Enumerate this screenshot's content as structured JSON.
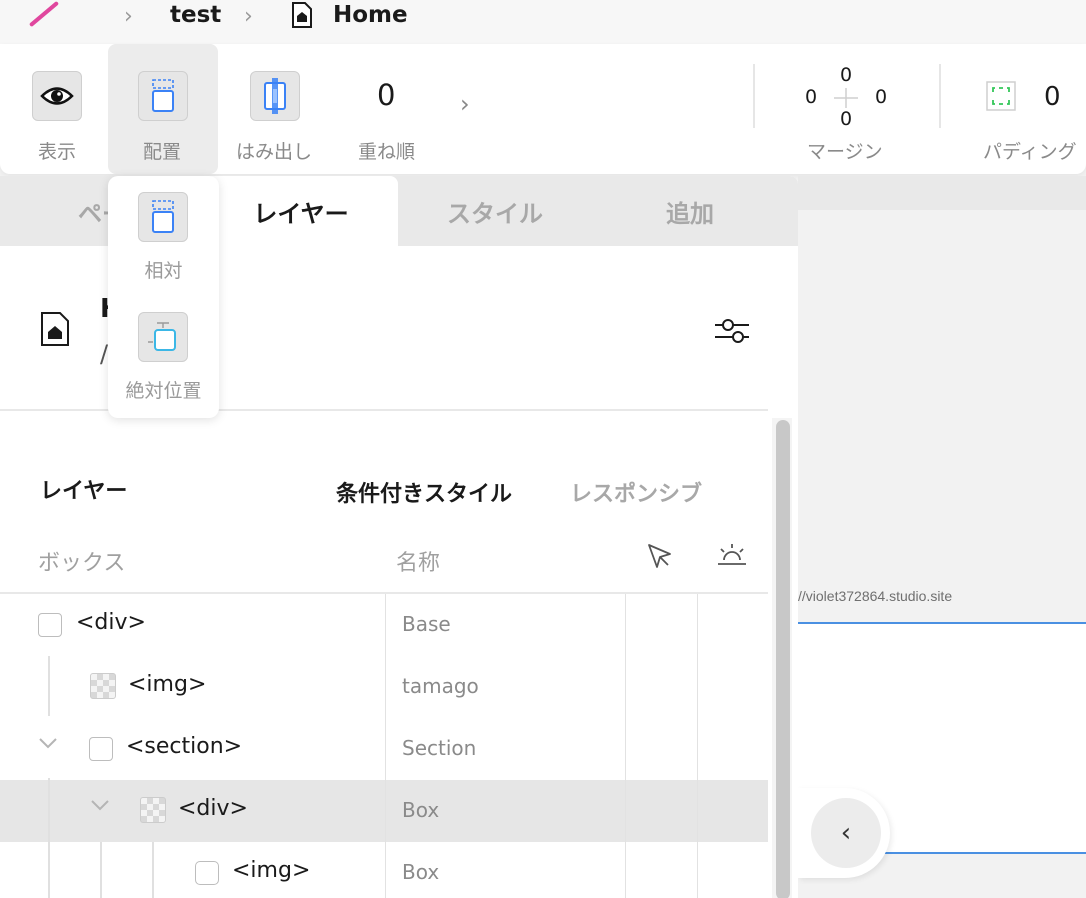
{
  "breadcrumb": {
    "project": "test",
    "page": "Home"
  },
  "toolbar": {
    "display_label": "表示",
    "placement_label": "配置",
    "overflow_label": "はみ出し",
    "zorder_value": "0",
    "zorder_label": "重ね順",
    "margin": {
      "top": "0",
      "right": "0",
      "bottom": "0",
      "left": "0",
      "label": "マージン"
    },
    "padding": {
      "value": "0",
      "label": "パディング"
    }
  },
  "placement_menu": {
    "relative": "相対",
    "absolute": "絶対位置"
  },
  "tabs": {
    "pages": "ペー",
    "layers": "レイヤー",
    "style": "スタイル",
    "add": "追加"
  },
  "page_info": {
    "title": "H",
    "path": "/"
  },
  "layers": {
    "title": "レイヤー",
    "conditional_style": "条件付きスタイル",
    "responsive": "レスポンシブ",
    "col_box": "ボックス",
    "col_name": "名称",
    "rows": [
      {
        "tag": "<div>",
        "name": "Base"
      },
      {
        "tag": "<img>",
        "name": "tamago"
      },
      {
        "tag": "<section>",
        "name": "Section"
      },
      {
        "tag": "<div>",
        "name": "Box"
      },
      {
        "tag": "<img>",
        "name": "Box"
      }
    ]
  },
  "canvas": {
    "url": "//violet372864.studio.site"
  },
  "colors": {
    "accent_pink": "#e0479e",
    "selection_blue": "#4a90e2",
    "placement_icon_blue": "#3b82f6",
    "padding_icon_green": "#34c759"
  }
}
